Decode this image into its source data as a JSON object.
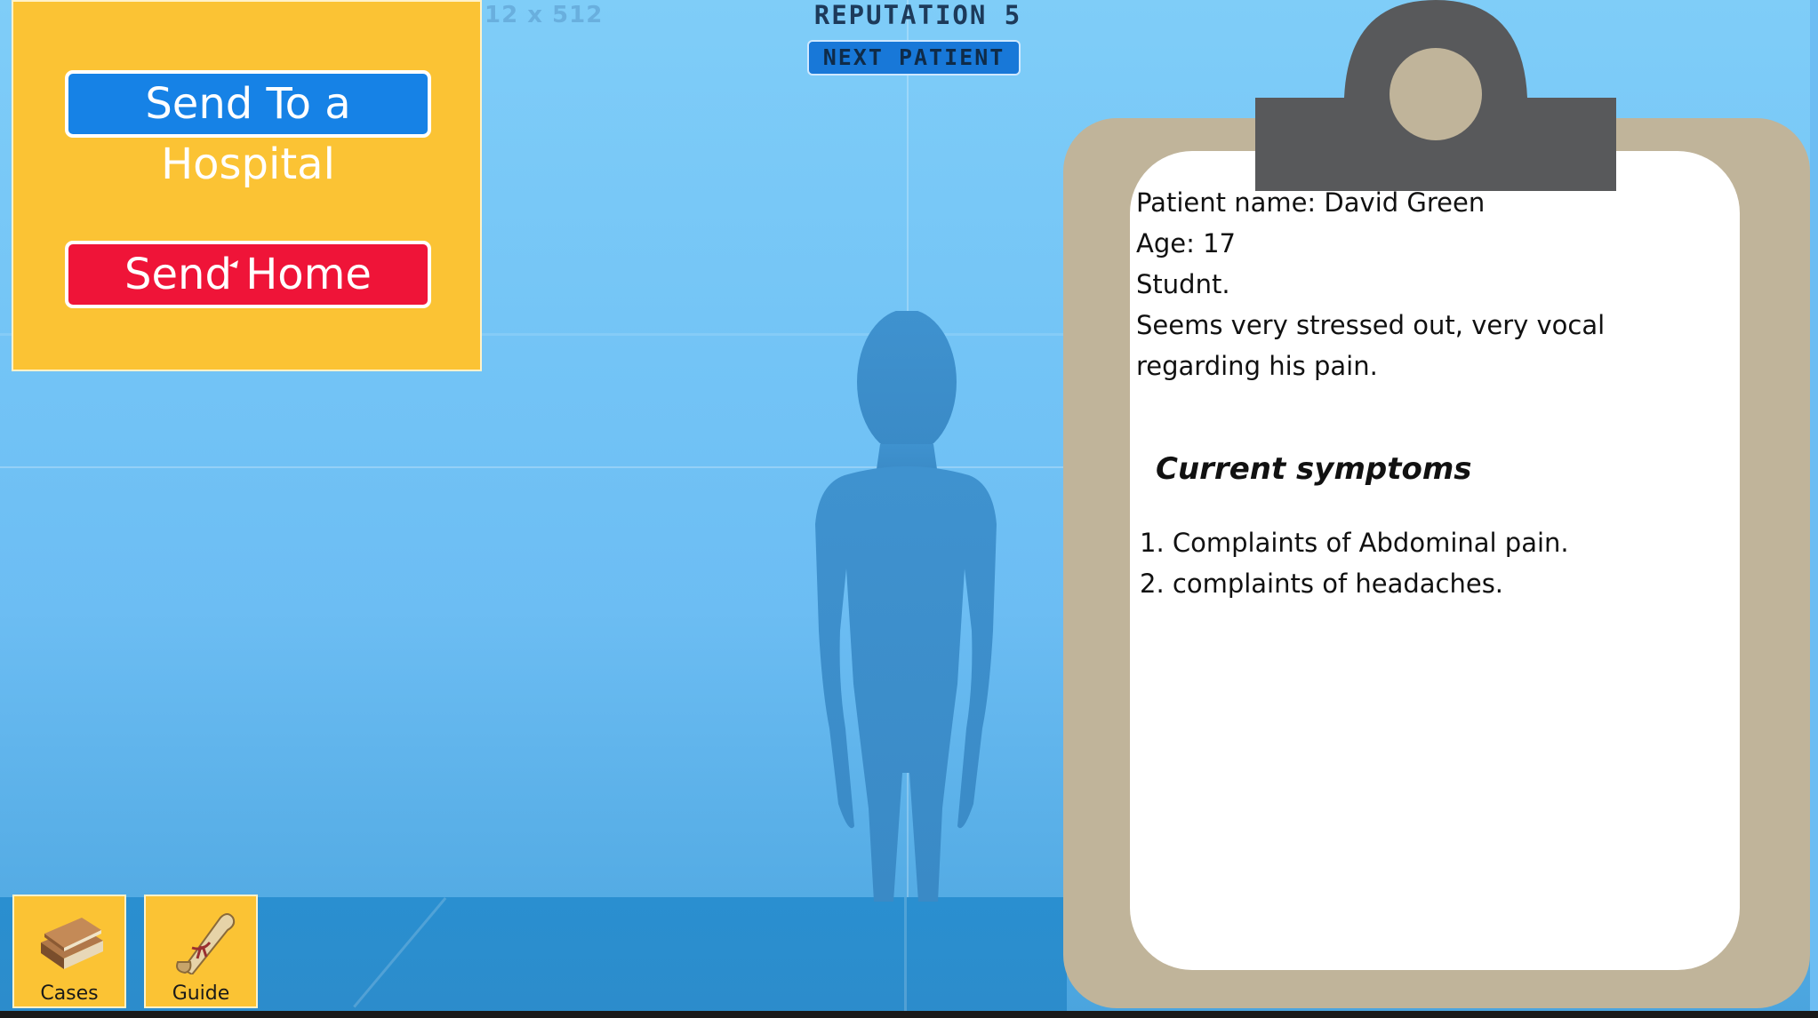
{
  "hud": {
    "reputation": "REPUTATION 5",
    "next_patient": "NEXT PATIENT",
    "ghost_text": "12 x 512"
  },
  "actions": {
    "send_hospital": "Send To a Hospital",
    "send_home": "Send Home"
  },
  "clipboard": {
    "patient_name": "Patient name: David Green",
    "age": "Age: 17",
    "occupation": "Studnt.",
    "note": "Seems very stressed out, very vocal regarding his pain.",
    "symptoms_title": "Current symptoms",
    "symptoms": [
      "1. Complaints of Abdominal pain.",
      "2. complaints of headaches."
    ]
  },
  "toolbar": {
    "cases_label": "Cases",
    "guide_label": "Guide"
  },
  "colors": {
    "panel": "#fbc334",
    "hospital_button": "#1682e6",
    "home_button": "#ef1438",
    "clipboard_board": "#c0b49a",
    "clip": "#58595b",
    "figure": "#3d8fcb"
  },
  "icons": {
    "cases": "book-icon",
    "guide": "scroll-icon"
  }
}
